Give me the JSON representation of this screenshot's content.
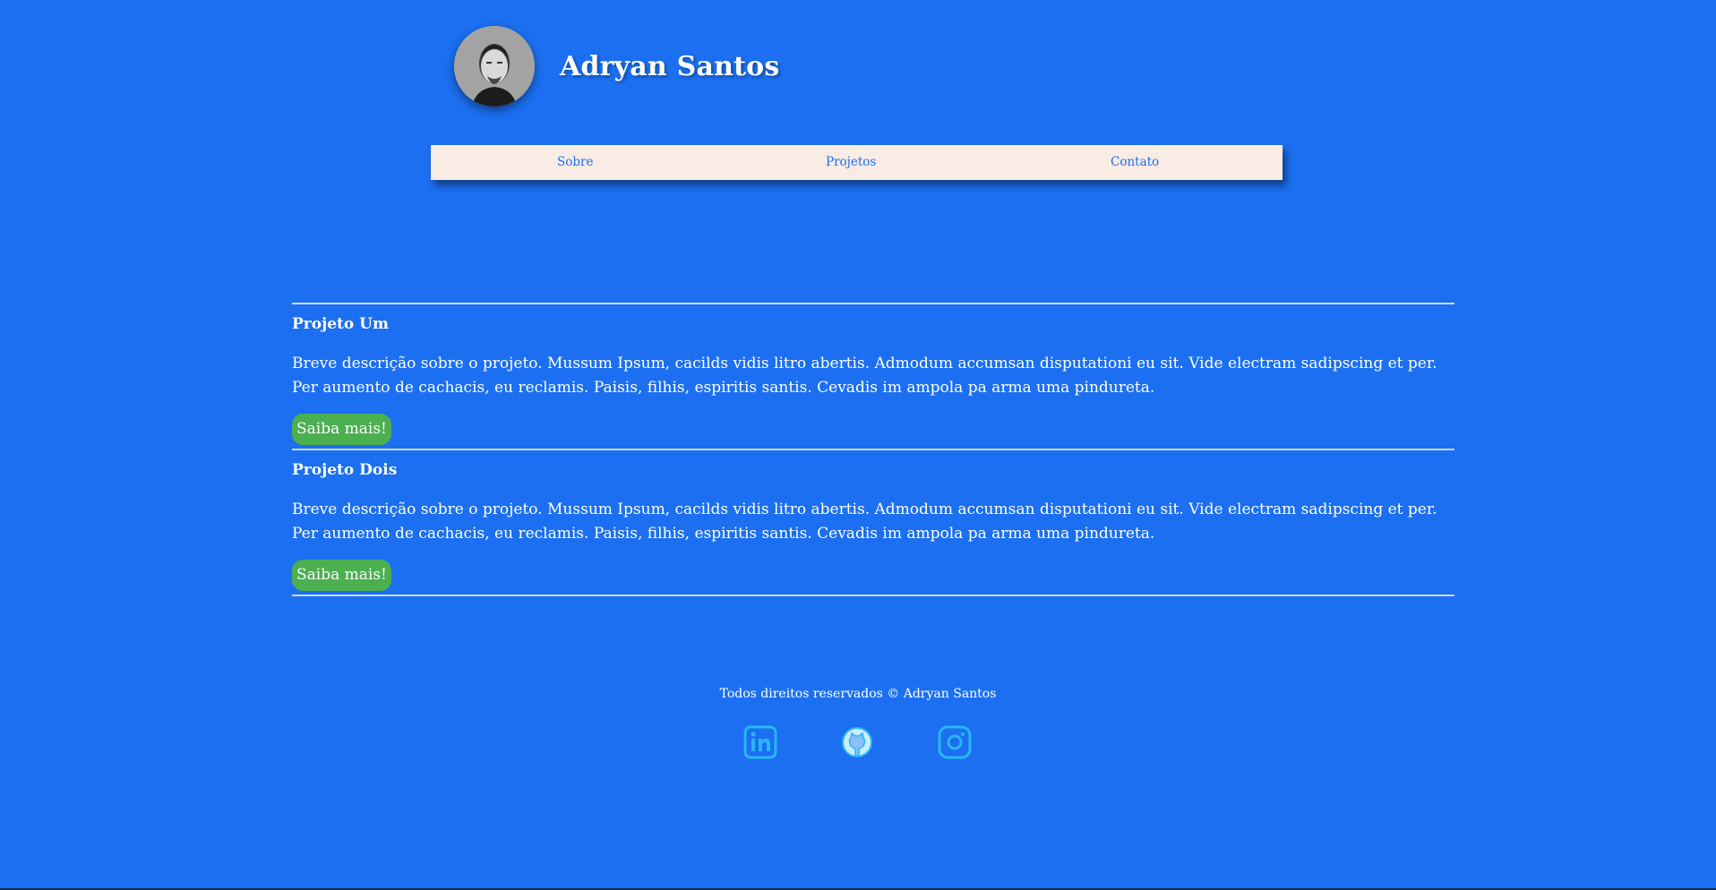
{
  "header": {
    "name": "Adryan Santos",
    "avatar_icon": "profile-photo"
  },
  "nav": {
    "items": [
      {
        "label": "Sobre"
      },
      {
        "label": "Projetos"
      },
      {
        "label": "Contato"
      }
    ]
  },
  "projects": [
    {
      "title": "Projeto Um",
      "description": "Breve descrição sobre o projeto. Mussum Ipsum, cacilds vidis litro abertis. Admodum accumsan disputationi eu sit. Vide electram sadipscing et per. Per aumento de cachacis, eu reclamis. Paisis, filhis, espiritis santis. Cevadis im ampola pa arma uma pindureta.",
      "button": "Saiba mais!"
    },
    {
      "title": "Projeto Dois",
      "description": "Breve descrição sobre o projeto. Mussum Ipsum, cacilds vidis litro abertis. Admodum accumsan disputationi eu sit. Vide electram sadipscing et per. Per aumento de cachacis, eu reclamis. Paisis, filhis, espiritis santis. Cevadis im ampola pa arma uma pindureta.",
      "button": "Saiba mais!"
    }
  ],
  "footer": {
    "text": "Todos direitos reservados © Adryan Santos",
    "socials": [
      {
        "icon": "linkedin-icon"
      },
      {
        "icon": "github-icon"
      },
      {
        "icon": "instagram-icon"
      }
    ]
  },
  "colors": {
    "background": "#1b6ff0",
    "nav_background": "#f8ece4",
    "button": "#4caf50",
    "social_icon": "#29b6f6"
  }
}
